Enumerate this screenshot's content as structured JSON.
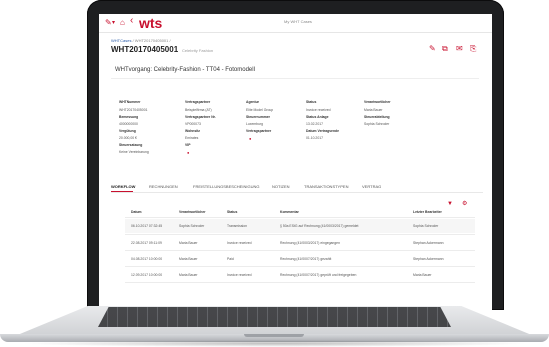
{
  "app": {
    "logo_text": "wts",
    "top_center": "My WHT Cases",
    "accent_color": "#c8102e"
  },
  "topbar_icons": {
    "left": [
      "edit-icon",
      "chevron-down-icon",
      "home-icon",
      "back-icon"
    ],
    "right": [
      "edit-icon",
      "copy-icon",
      "mail-icon",
      "export-icon"
    ]
  },
  "breadcrumb": {
    "first": "WHTCases",
    "rest": " / WHT20170405001 /"
  },
  "page": {
    "title": "WHT20170405001",
    "subtitle_small": "Celebrity Fashion",
    "process": "WHTvorgang: Celebrity-Fashion - TT04 - Fotomodell"
  },
  "details": {
    "col1": {
      "header": "WHTNummer",
      "values": [
        "WHT20170405001",
        "Bemessung",
        "4000000000",
        "Vergütung",
        "20.000,00 €",
        "Steuersatzung",
        "Keine Vereinbarung"
      ]
    },
    "col2": {
      "header": "Vertragspartner",
      "values": [
        "Beispielfirma (AT)",
        "Vertragspartner Nr.",
        "VP000073",
        "Wohnsitz",
        "Emirates",
        "VIP",
        "●"
      ]
    },
    "col3": {
      "header": "Agentur",
      "values": [
        "Elite Model Group",
        "Steuernummer",
        "Luxemburg",
        "Vertragspartner",
        "●"
      ]
    },
    "col4": {
      "header": "Status",
      "values": [
        "Invoice received",
        "Status Anlage",
        "13.02.2017",
        "Datum Vertragsende",
        "01.10.2017"
      ]
    },
    "col5": {
      "header": "Verantwortlicher",
      "values": [
        "Maria Bauer",
        "Steuerabteilung",
        "Sophia Schroder"
      ]
    }
  },
  "tabs": [
    {
      "label": "WORKFLOW",
      "active": true
    },
    {
      "label": "RECHNUNGEN",
      "active": false
    },
    {
      "label": "FREISTELLUNGSBESCHEINIGUNG",
      "active": false
    },
    {
      "label": "NOTIZEN",
      "active": false
    },
    {
      "label": "TRANSAKTIONSTYPEN",
      "active": false
    },
    {
      "label": "VERTRAG",
      "active": false
    }
  ],
  "workflow_table": {
    "columns": [
      "Datum",
      "Verantwortlicher",
      "Status",
      "Kommentar",
      "Letzter Bearbeiter"
    ],
    "rows": [
      [
        "06.10.2017 07:32:45",
        "Sophia Schroder",
        "Transmission",
        "§ 50a EStG auf Rechnung (41/0003/2017) gemeldet",
        "Sophia Schroder"
      ],
      [
        "22.08.2017 09:11:09",
        "Maria Bauer",
        "Invoice received",
        "Rechnung (41/0003/2017) eingegangen",
        "Stephan Ackermann"
      ],
      [
        "04.08.2017 10:00:00",
        "Maria Bauer",
        "Paid",
        "Rechnung (41/0007/2017) gezahlt",
        "Stephan Ackermann"
      ],
      [
        "12.09.2017 10:00:00",
        "Maria Bauer",
        "Invoice received",
        "Rechnung (41/0007/2017) geprüft und freigegeben",
        "Maria Bauer"
      ]
    ]
  }
}
